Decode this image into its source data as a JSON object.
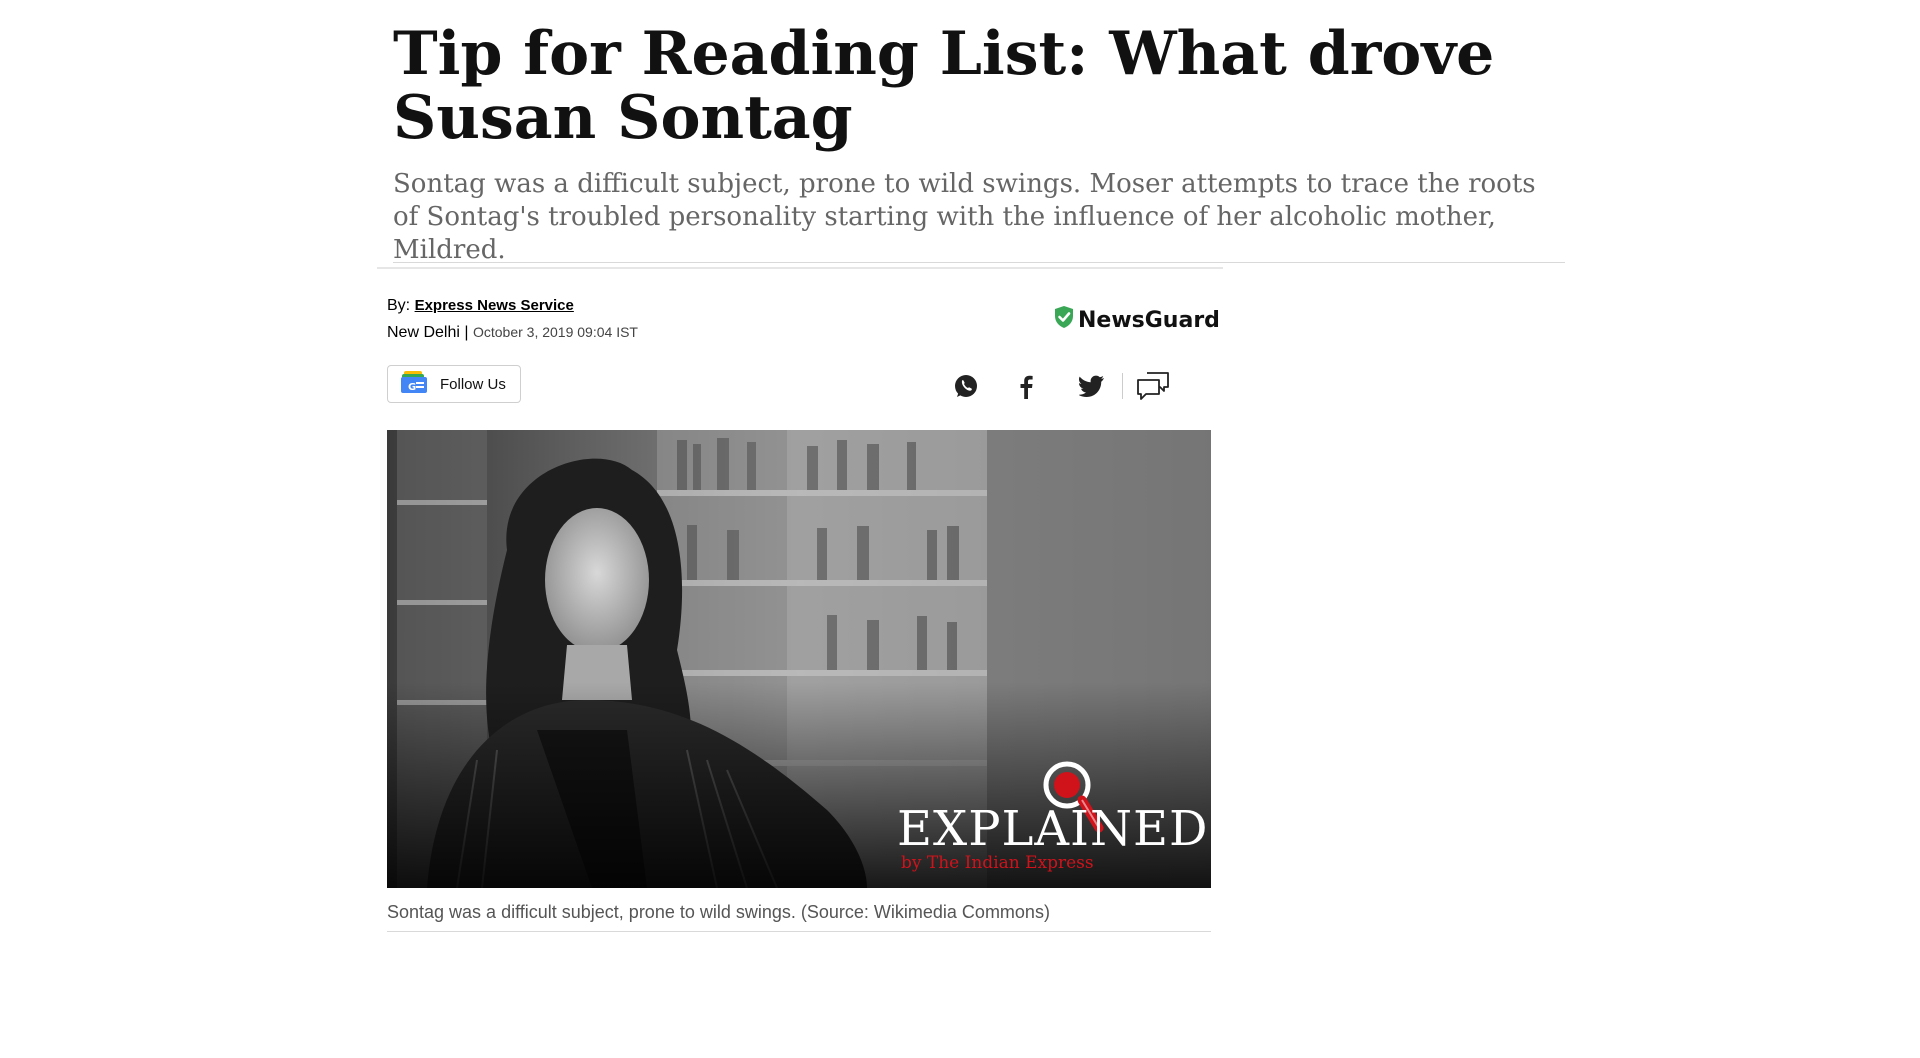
{
  "article": {
    "title": "Tip for Reading List: What drove Susan Sontag",
    "subtitle": "Sontag was a difficult subject, prone to wild swings. Moser attempts to trace the roots of Sontag's troubled personality starting with the influence of her alcoholic mother, Mildred.",
    "byline_prefix": "By:",
    "author": "Express News Service",
    "location": "New Delhi",
    "separator": "|",
    "date": "October 3, 2019 09:04 IST",
    "newsguard_label": "NewsGuard",
    "follow_label": "Follow Us",
    "follow_icon_text": "G",
    "image_caption": "Sontag was a difficult subject, prone to wild swings. (Source: Wikimedia Commons)",
    "explained_logo": {
      "text": "EXPLAINED",
      "subtext": "by The Indian Express"
    }
  },
  "share_icons": [
    "whatsapp-icon",
    "facebook-icon",
    "twitter-icon",
    "comment-icon"
  ],
  "colors": {
    "newsguard_shield": "#3aa757",
    "explained_red": "#d0121b",
    "subtitle_gray": "#666666"
  }
}
